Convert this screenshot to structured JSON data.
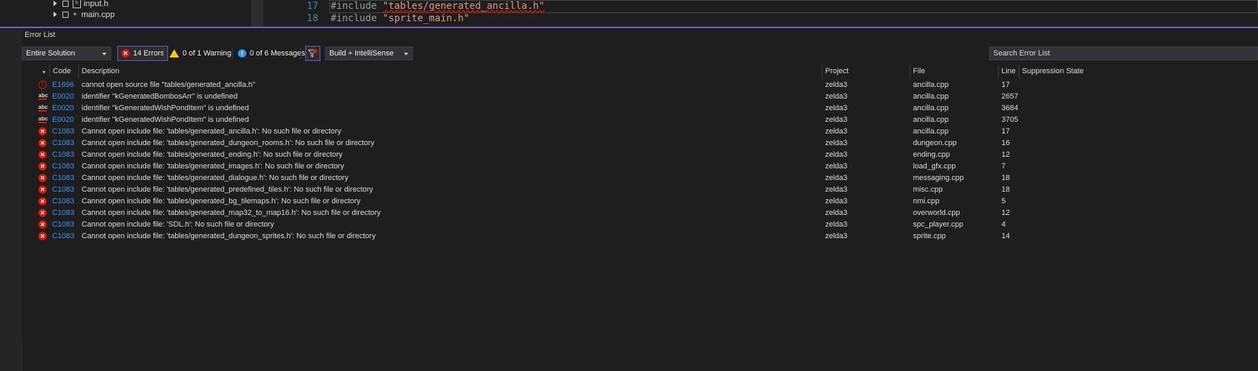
{
  "solution_tree": {
    "items": [
      {
        "name": "input.h",
        "icon": "header-file-icon"
      },
      {
        "name": "main.cpp",
        "icon": "cpp-file-icon"
      }
    ]
  },
  "editor": {
    "lines": [
      {
        "number": "17",
        "directive": "#include",
        "string": "\"tables/generated_ancilla.h\""
      },
      {
        "number": "18",
        "directive": "#include",
        "string": "\"sprite_main.h\""
      }
    ]
  },
  "panel": {
    "title": "Error List"
  },
  "toolbar": {
    "scope": "Entire Solution",
    "errors_label": "14 Errors",
    "warnings_label": "0 of 1 Warning",
    "messages_label": "0 of 6 Messages",
    "build_filter": "Build + IntelliSense",
    "search_placeholder": "Search Error List"
  },
  "columns": {
    "code": "Code",
    "description": "Description",
    "project": "Project",
    "file": "File",
    "line": "Line",
    "suppression": "Suppression State"
  },
  "errors": [
    {
      "icon": "intellisense-error-icon",
      "code": "E1696",
      "description": "cannot open source file \"tables/generated_ancilla.h\"",
      "project": "zelda3",
      "file": "ancilla.cpp",
      "line": "17"
    },
    {
      "icon": "spelling-error-icon",
      "code": "E0020",
      "description": "identifier \"kGeneratedBombosArr\" is undefined",
      "project": "zelda3",
      "file": "ancilla.cpp",
      "line": "2657"
    },
    {
      "icon": "spelling-error-icon",
      "code": "E0020",
      "description": "identifier \"kGeneratedWishPondItem\" is undefined",
      "project": "zelda3",
      "file": "ancilla.cpp",
      "line": "3684"
    },
    {
      "icon": "spelling-error-icon",
      "code": "E0020",
      "description": "identifier \"kGeneratedWishPondItem\" is undefined",
      "project": "zelda3",
      "file": "ancilla.cpp",
      "line": "3705"
    },
    {
      "icon": "error-icon",
      "code": "C1083",
      "description": "Cannot open include file: 'tables/generated_ancilla.h': No such file or directory",
      "project": "zelda3",
      "file": "ancilla.cpp",
      "line": "17"
    },
    {
      "icon": "error-icon",
      "code": "C1083",
      "description": "Cannot open include file: 'tables/generated_dungeon_rooms.h': No such file or directory",
      "project": "zelda3",
      "file": "dungeon.cpp",
      "line": "16"
    },
    {
      "icon": "error-icon",
      "code": "C1083",
      "description": "Cannot open include file: 'tables/generated_ending.h': No such file or directory",
      "project": "zelda3",
      "file": "ending.cpp",
      "line": "12"
    },
    {
      "icon": "error-icon",
      "code": "C1083",
      "description": "Cannot open include file: 'tables/generated_images.h': No such file or directory",
      "project": "zelda3",
      "file": "load_gfx.cpp",
      "line": "7"
    },
    {
      "icon": "error-icon",
      "code": "C1083",
      "description": "Cannot open include file: 'tables/generated_dialogue.h': No such file or directory",
      "project": "zelda3",
      "file": "messaging.cpp",
      "line": "18"
    },
    {
      "icon": "error-icon",
      "code": "C1083",
      "description": "Cannot open include file: 'tables/generated_predefined_tiles.h': No such file or directory",
      "project": "zelda3",
      "file": "misc.cpp",
      "line": "18"
    },
    {
      "icon": "error-icon",
      "code": "C1083",
      "description": "Cannot open include file: 'tables/generated_bg_tilemaps.h': No such file or directory",
      "project": "zelda3",
      "file": "nmi.cpp",
      "line": "5"
    },
    {
      "icon": "error-icon",
      "code": "C1083",
      "description": "Cannot open include file: 'tables/generated_map32_to_map16.h': No such file or directory",
      "project": "zelda3",
      "file": "overworld.cpp",
      "line": "12"
    },
    {
      "icon": "error-icon",
      "code": "C1083",
      "description": "Cannot open include file: 'SDL.h': No such file or directory",
      "project": "zelda3",
      "file": "spc_player.cpp",
      "line": "4"
    },
    {
      "icon": "error-icon",
      "code": "C1083",
      "description": "Cannot open include file: 'tables/generated_dungeon_sprites.h': No such file or directory",
      "project": "zelda3",
      "file": "sprite.cpp",
      "line": "14"
    }
  ],
  "colors": {
    "error": "#e51400",
    "code_link": "#3794ff",
    "accent": "#7a5fcf",
    "warning": "#ffcc00"
  }
}
